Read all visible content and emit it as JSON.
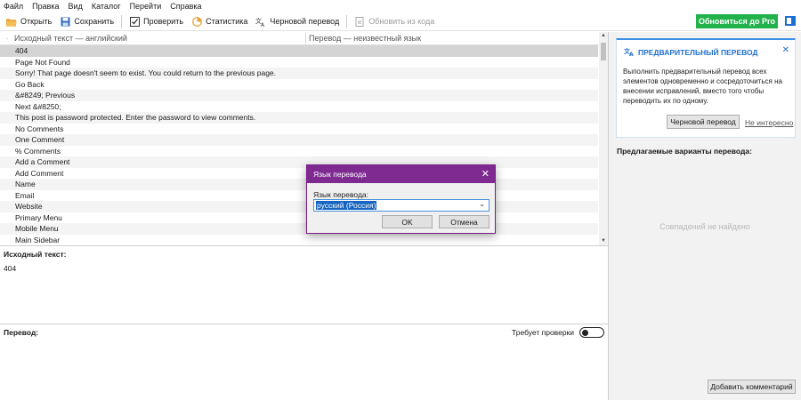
{
  "menu": {
    "items": [
      "Файл",
      "Правка",
      "Вид",
      "Каталог",
      "Перейти",
      "Справка"
    ]
  },
  "toolbar": {
    "open": "Открыть",
    "save": "Сохранить",
    "validate": "Проверить",
    "statistics": "Статистика",
    "pretranslate": "Черновой перевод",
    "update_from_code": "Обновить из кода",
    "upgrade": "Обновиться до Pro"
  },
  "list": {
    "header_source": "Исходный текст — английский",
    "header_translation": "Перевод — неизвестный язык",
    "rows": [
      "404",
      "Page  Not Found",
      "Sorry! That page doesn't seem to exist. You could return to the previous page.",
      "Go Back",
      "&#8249; Previous",
      "Next &#8250;",
      "This post is password protected. Enter the password to view comments.",
      "No Comments",
      "One Comment",
      "% Comments",
      "Add a Comment",
      "Add Comment",
      "Name",
      "Email",
      "Website",
      "Primary Menu",
      "Mobile Menu",
      "Main Sidebar"
    ]
  },
  "source_pane": {
    "label": "Исходный текст:",
    "text": "404"
  },
  "translation_pane": {
    "label": "Перевод:",
    "needs_review": "Требует проверки"
  },
  "sidebar": {
    "info_title": "ПРЕДВАРИТЕЛЬНЫЙ ПЕРЕВОД",
    "info_body": "Выполнить предварительный перевод всех элементов одновременно и сосредоточиться на внесении исправлений, вместо того чтобы переводить их по одному.",
    "info_button": "Черновой перевод",
    "info_link": "Не интересно",
    "suggestions_label": "Предлагаемые варианты перевода:",
    "no_matches": "Совпадений не найдено",
    "add_comment": "Добавить комментарий"
  },
  "dialog": {
    "title": "Язык перевода",
    "label": "Язык перевода:",
    "selected_language": "русский (Россия)",
    "ok": "OK",
    "cancel": "Отмена"
  },
  "colors": {
    "accent_green": "#22b24c",
    "dialog_purple": "#7e2a91",
    "info_blue": "#1f6fcf"
  }
}
